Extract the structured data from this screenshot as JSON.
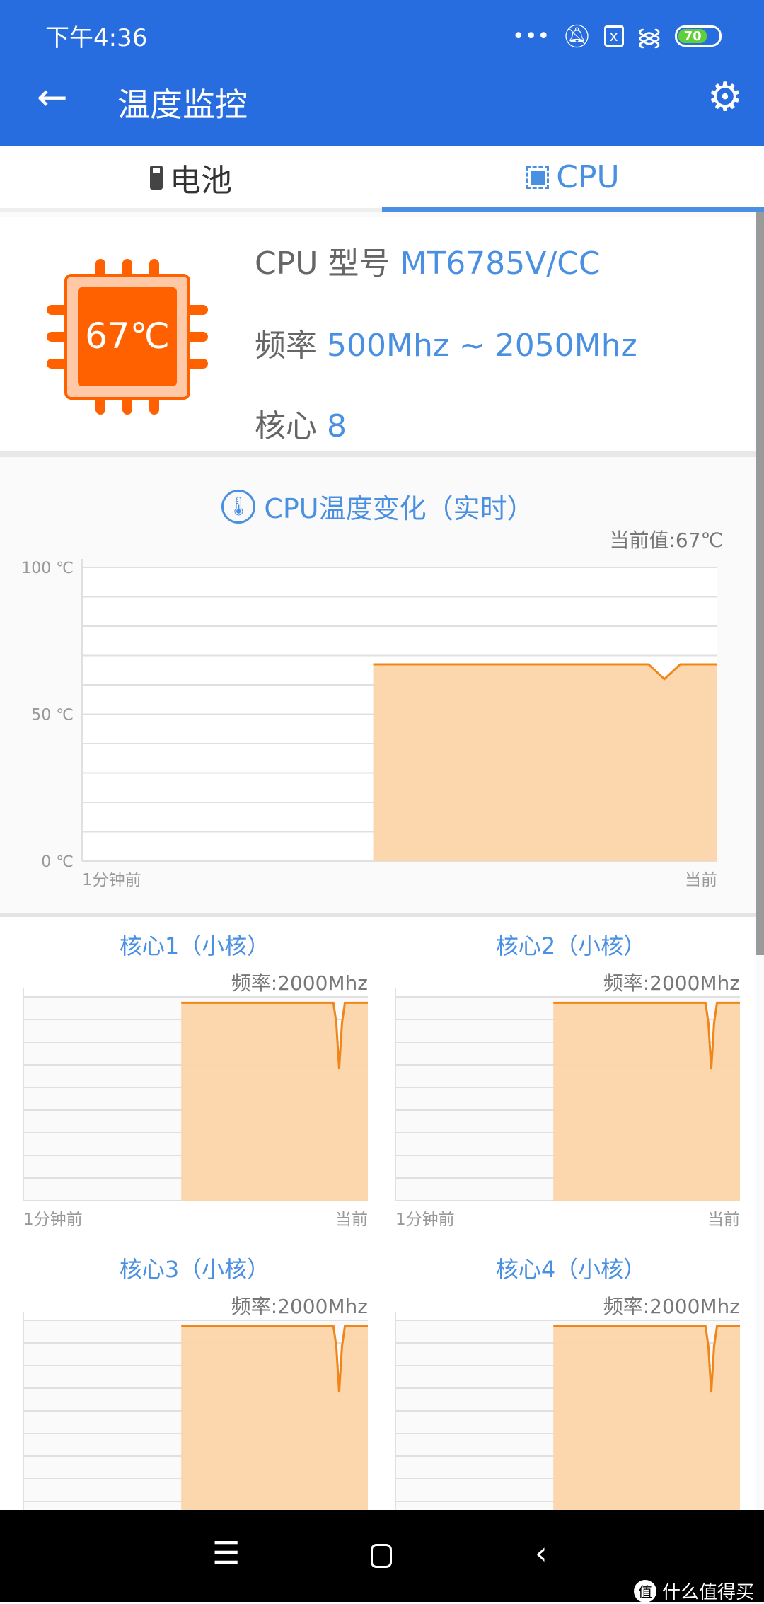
{
  "status": {
    "time": "下午4:36",
    "battery": "70",
    "battery_color": "#5fcf3a"
  },
  "header": {
    "title": "温度监控",
    "back_icon": "arrow-left",
    "settings_icon": "gear"
  },
  "tabs": [
    {
      "label": "电池",
      "icon": "battery"
    },
    {
      "label": "CPU",
      "icon": "chip",
      "active": true
    }
  ],
  "cpu_info": {
    "temp_badge": "67℃",
    "model_label": "CPU 型号",
    "model": "MT6785V/CC",
    "freq_label": "频率",
    "freq": "500Mhz ~ 2050Mhz",
    "cores_label": "核心",
    "cores": "8",
    "accent": "#ff6000"
  },
  "main_chart": {
    "title": "CPU温度变化（实时）",
    "current": "当前值:67℃"
  },
  "colors": {
    "primary": "#276ddf",
    "accent": "#4a90e2",
    "line": "#f0861a",
    "fill": "#fcd4a8"
  },
  "chart_data": [
    {
      "type": "area",
      "name": "cpu-temp",
      "ylim": [
        0,
        100
      ],
      "yticks": [
        "100 ℃",
        "50 ℃",
        "0 ℃"
      ],
      "ytick_values": [
        100,
        50,
        0
      ],
      "xlim": [
        -60,
        0
      ],
      "xlabels": [
        "1分钟前",
        "当前"
      ],
      "grid": true,
      "x": [
        -32.5,
        -8,
        -6.5,
        -5,
        -3.5,
        -2,
        0
      ],
      "y": [
        67,
        67,
        67,
        62,
        67,
        67,
        67
      ]
    },
    {
      "type": "area",
      "name": "core-1",
      "title": "核心1（小核）",
      "subtitle": "频率:2000Mhz",
      "xlim": [
        -60,
        0
      ],
      "ylim": [
        0,
        2060
      ],
      "xlabels": [
        "1分钟前",
        "当前"
      ],
      "grid": true,
      "x": [
        -32.5,
        -6,
        -5.5,
        -5,
        -4.5,
        -4,
        0
      ],
      "y": [
        2000,
        2000,
        1800,
        1330,
        1800,
        2000,
        2000
      ]
    },
    {
      "type": "area",
      "name": "core-2",
      "title": "核心2（小核）",
      "subtitle": "频率:2000Mhz",
      "xlim": [
        -60,
        0
      ],
      "ylim": [
        0,
        2060
      ],
      "xlabels": [
        "1分钟前",
        "当前"
      ],
      "grid": true,
      "x": [
        -32.5,
        -6,
        -5.5,
        -5,
        -4.5,
        -4,
        0
      ],
      "y": [
        2000,
        2000,
        1800,
        1330,
        1800,
        2000,
        2000
      ]
    },
    {
      "type": "area",
      "name": "core-3",
      "title": "核心3（小核）",
      "subtitle": "频率:2000Mhz",
      "xlim": [
        -60,
        0
      ],
      "ylim": [
        0,
        2060
      ],
      "grid": true,
      "x": [
        -32.5,
        -6,
        -5.5,
        -5,
        -4.5,
        -4,
        0
      ],
      "y": [
        2000,
        2000,
        1800,
        1330,
        1800,
        2000,
        2000
      ]
    },
    {
      "type": "area",
      "name": "core-4",
      "title": "核心4（小核）",
      "subtitle": "频率:2000Mhz",
      "xlim": [
        -60,
        0
      ],
      "ylim": [
        0,
        2060
      ],
      "grid": true,
      "x": [
        -32.5,
        -6,
        -5.5,
        -5,
        -4.5,
        -4,
        0
      ],
      "y": [
        2000,
        2000,
        1800,
        1330,
        1800,
        2000,
        2000
      ]
    }
  ],
  "watermark": "什么值得买"
}
